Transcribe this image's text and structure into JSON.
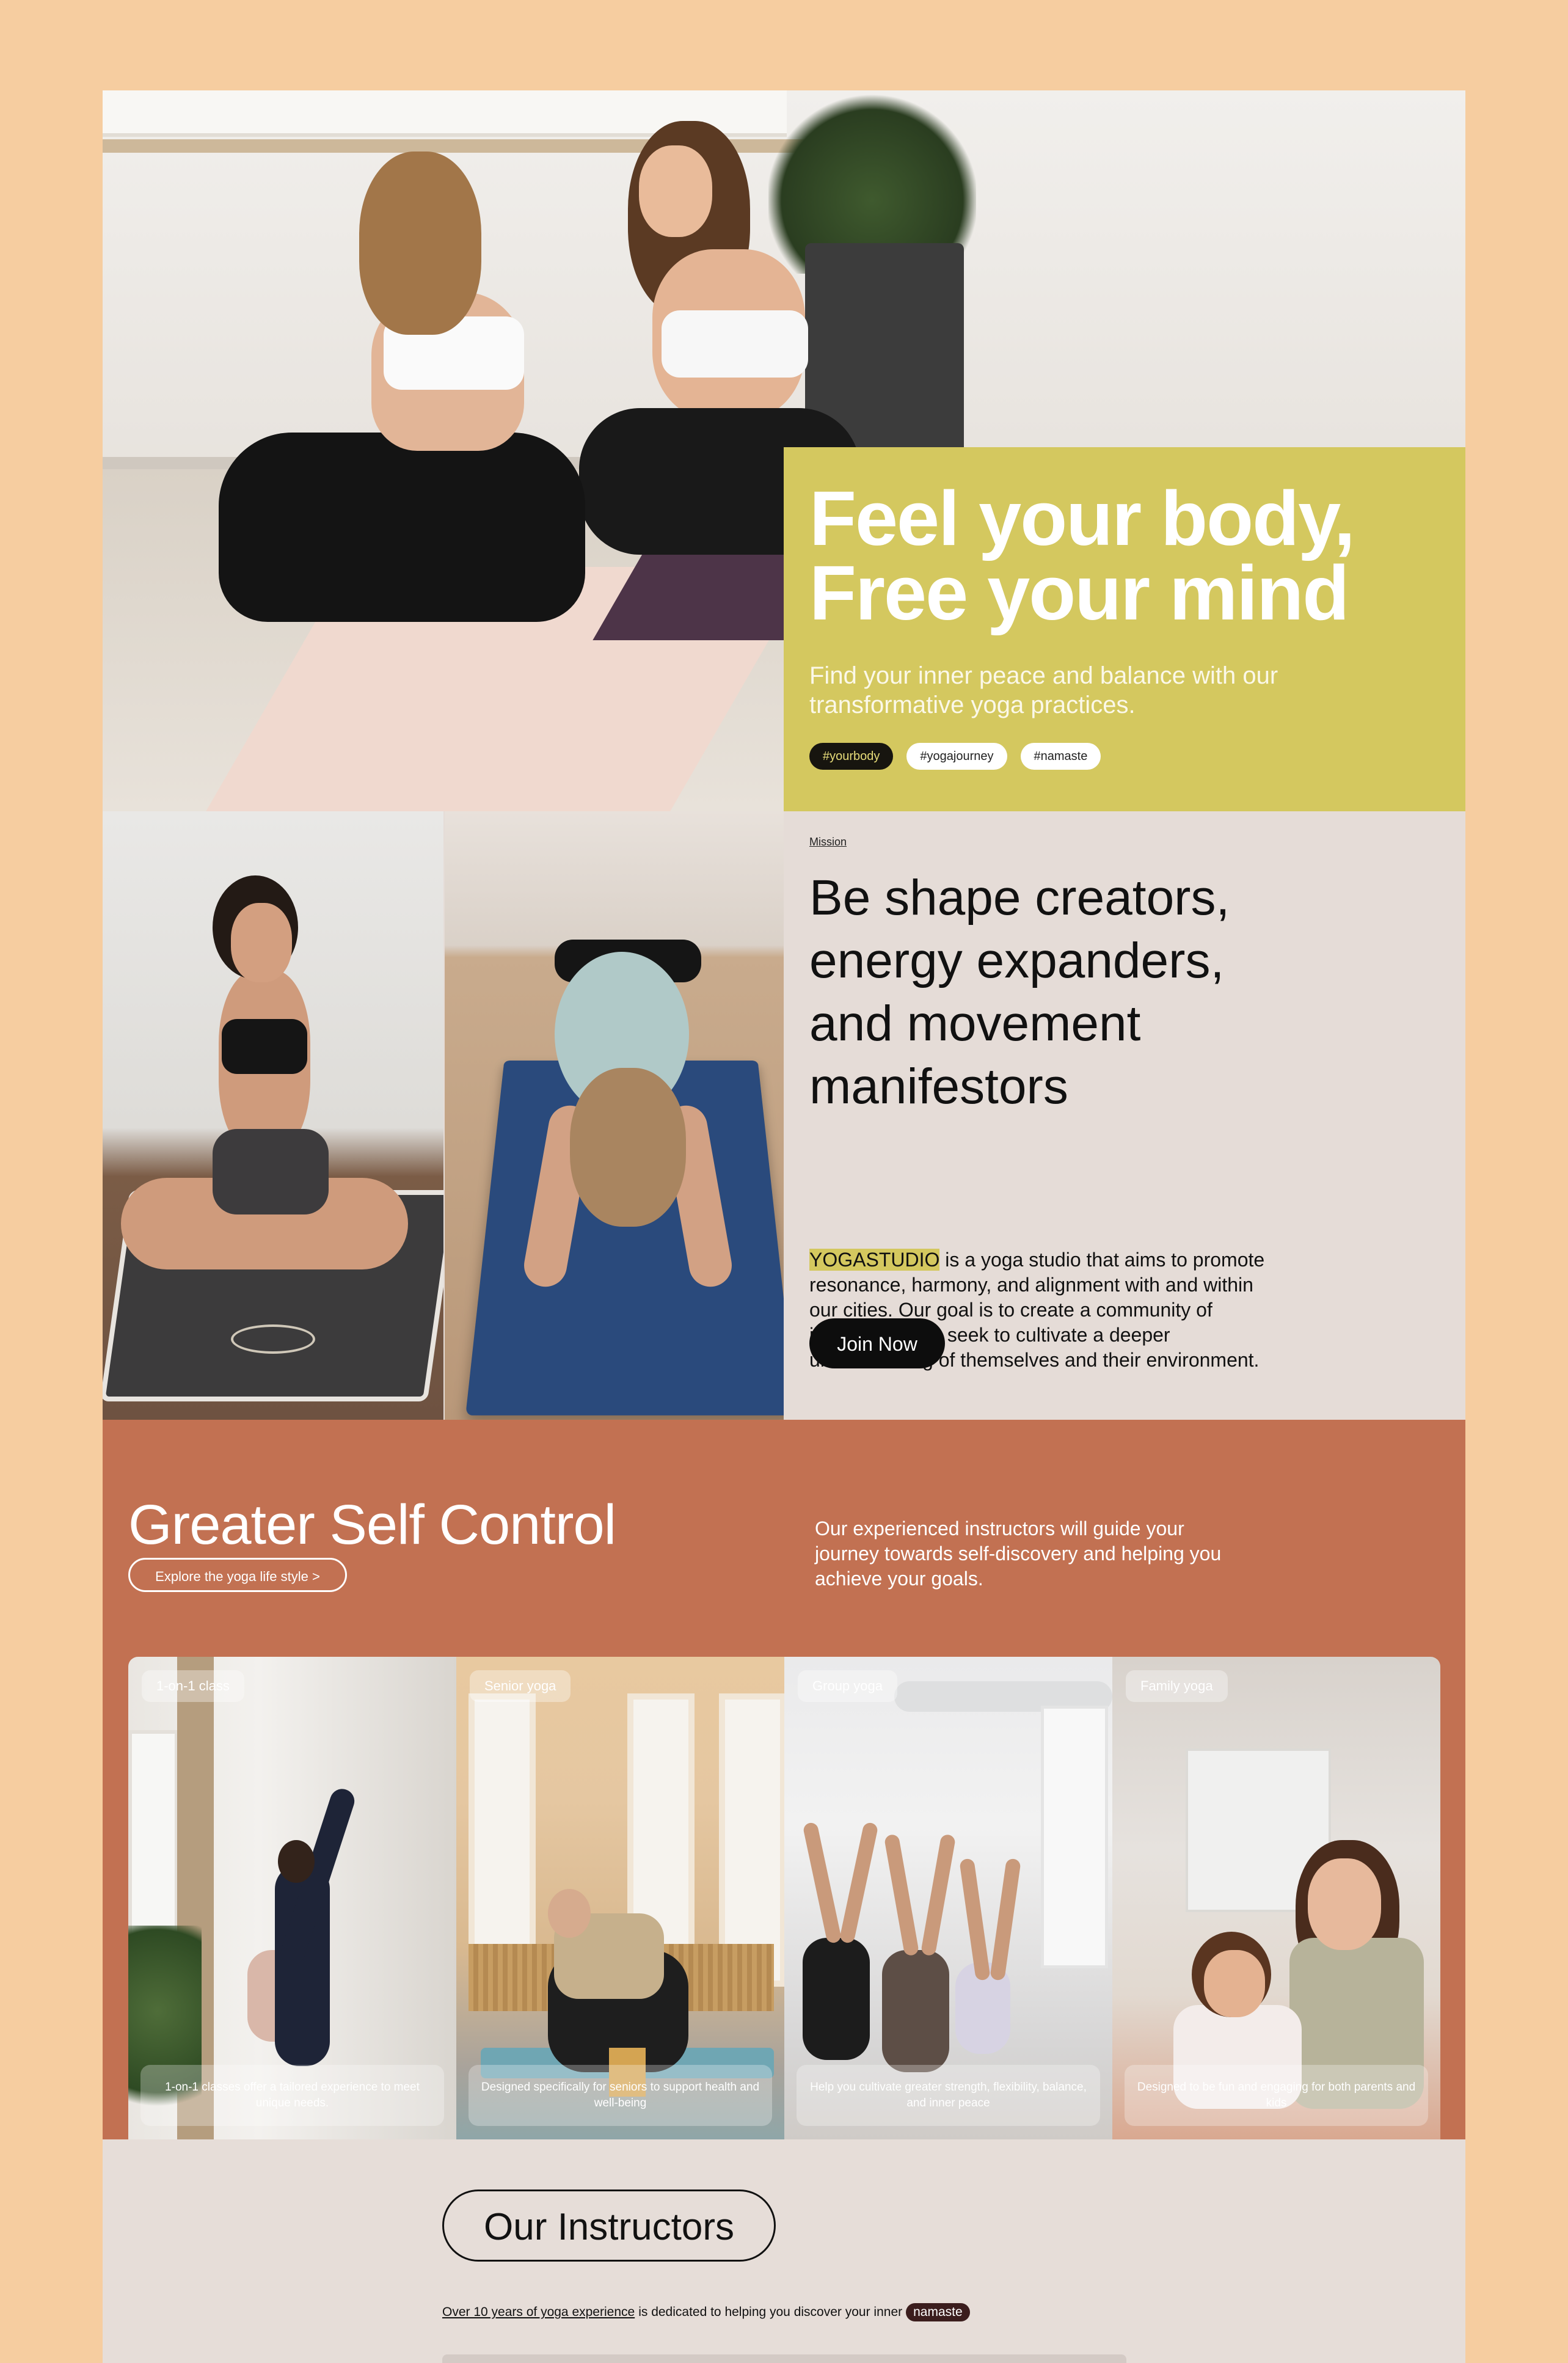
{
  "hero": {
    "title_line1": "Feel your body,",
    "title_line2": "Free your mind",
    "subtitle": "Find your inner peace and balance with our transformative yoga practices.",
    "tags": [
      "#yourbody",
      "#yogajourney",
      "#namaste"
    ]
  },
  "mission": {
    "label": "Mission",
    "title_lines": [
      "Be shape creators,",
      "energy expanders,",
      "and movement",
      "manifestors"
    ],
    "brand": "YOGASTUDIO",
    "body": " is a yoga studio that aims to promote resonance, harmony, and alignment with and within our cities. Our goal is to create a community of individuals who seek to cultivate a deeper understanding of themselves and their environment.",
    "cta_label": "Join Now"
  },
  "self_control": {
    "title": "Greater Self Control",
    "link_label": "Explore the yoga life style >",
    "description": "Our experienced instructors will guide your journey towards self-discovery and helping you achieve your goals.",
    "cards": [
      {
        "tag": "1-on-1 class",
        "description": "1-on-1 classes offer a tailored experience to meet unique needs."
      },
      {
        "tag": "Senior yoga",
        "description": "Designed specifically for seniors to support health and well-being"
      },
      {
        "tag": "Group yoga",
        "description": "Help you cultivate greater strength, flexibility, balance, and inner peace"
      },
      {
        "tag": "Family yoga",
        "description": "Designed to be fun and engaging for both parents and kids"
      }
    ]
  },
  "instructors": {
    "title": "Our Instructors",
    "experience_link": "Over 10 years of yoga experience",
    "line_mid": "is dedicated to helping you discover your inner",
    "pill": "namaste"
  },
  "colors": {
    "page_bg": "#f6cda0",
    "hero_card": "#d4c85f",
    "mission_bg": "#e5dcd7",
    "self_control_bg": "#c27152",
    "button_dark": "#0d0d0d"
  }
}
